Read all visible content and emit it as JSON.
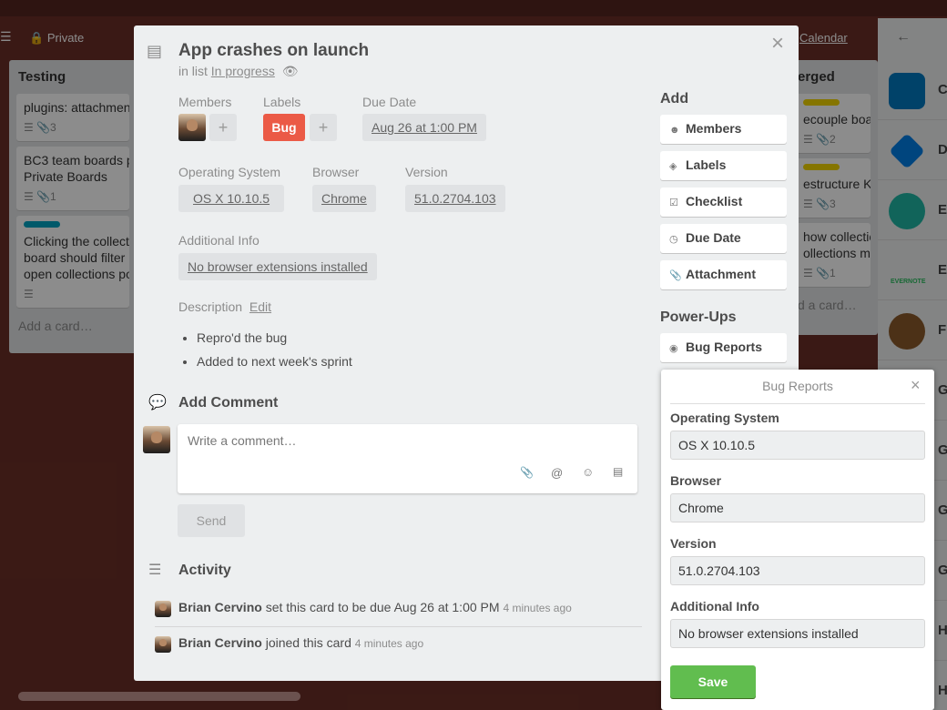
{
  "board": {
    "visibility": "Private",
    "calendar_label": "Calendar",
    "lists": [
      {
        "title": "Testing",
        "cards": [
          {
            "text": "plugins: attachment",
            "attachments": "3"
          },
          {
            "text": "BC3 team boards p… Private Boards",
            "line1": "BC3 team boards p",
            "line2": "Private Boards",
            "attachments": "1"
          },
          {
            "line1": "Clicking the collecti",
            "line2": "board should filter b",
            "line3": "open collections po",
            "label_color": "#00a2c2"
          }
        ],
        "add_card": "Add a card…"
      },
      {
        "title": "erged",
        "cards": [
          {
            "text": "ecouple board",
            "attachments": "2",
            "label_color": "#f2d600"
          },
          {
            "text": "estructure Kno",
            "attachments": "3",
            "label_color": "#f2d600"
          },
          {
            "line1": "how collection",
            "line2": "ollections men",
            "attachments": "1"
          }
        ],
        "add_card": "d a card…"
      }
    ]
  },
  "side_panel": {
    "letters": [
      "C",
      "D",
      "E",
      "E",
      "F",
      "G",
      "G",
      "G",
      "G",
      "H",
      "H"
    ],
    "evernote_caption": "EVERNOTE"
  },
  "card": {
    "title": "App crashes on launch",
    "in_list_prefix": "in list",
    "list_name": "In progress",
    "members_label": "Members",
    "labels_label": "Labels",
    "due_label": "Due Date",
    "label_bug": "Bug",
    "label_bug_color": "#eb5a46",
    "due_date": "Aug 26 at 1:00 PM",
    "fields": {
      "os_label": "Operating System",
      "os_value": "OS X 10.10.5",
      "browser_label": "Browser",
      "browser_value": "Chrome",
      "version_label": "Version",
      "version_value": "51.0.2704.103",
      "info_label": "Additional Info",
      "info_value": "No browser extensions installed"
    },
    "description_label": "Description",
    "description_edit": "Edit",
    "description_items": [
      "Repro'd the bug",
      "Added to next week's sprint"
    ],
    "add_comment_title": "Add Comment",
    "comment_placeholder": "Write a comment…",
    "send_label": "Send",
    "activity_title": "Activity",
    "activity": [
      {
        "user": "Brian Cervino",
        "action": "set this card to be due Aug 26 at 1:00 PM",
        "time": "4 minutes ago"
      },
      {
        "user": "Brian Cervino",
        "action": "joined this card",
        "time": "4 minutes ago"
      }
    ]
  },
  "sidebar": {
    "add_title": "Add",
    "buttons": [
      {
        "label": "Members",
        "icon": "person-icon"
      },
      {
        "label": "Labels",
        "icon": "tag-icon"
      },
      {
        "label": "Checklist",
        "icon": "checkbox-icon"
      },
      {
        "label": "Due Date",
        "icon": "clock-icon"
      },
      {
        "label": "Attachment",
        "icon": "paperclip-icon"
      }
    ],
    "powerups_title": "Power-Ups",
    "bug_reports_label": "Bug Reports"
  },
  "popover": {
    "title": "Bug Reports",
    "os_label": "Operating System",
    "os_value": "OS X 10.10.5",
    "browser_label": "Browser",
    "browser_value": "Chrome",
    "version_label": "Version",
    "version_value": "51.0.2704.103",
    "info_label": "Additional Info",
    "info_value": "No browser extensions installed",
    "save_label": "Save",
    "save_color": "#61bd4f"
  }
}
